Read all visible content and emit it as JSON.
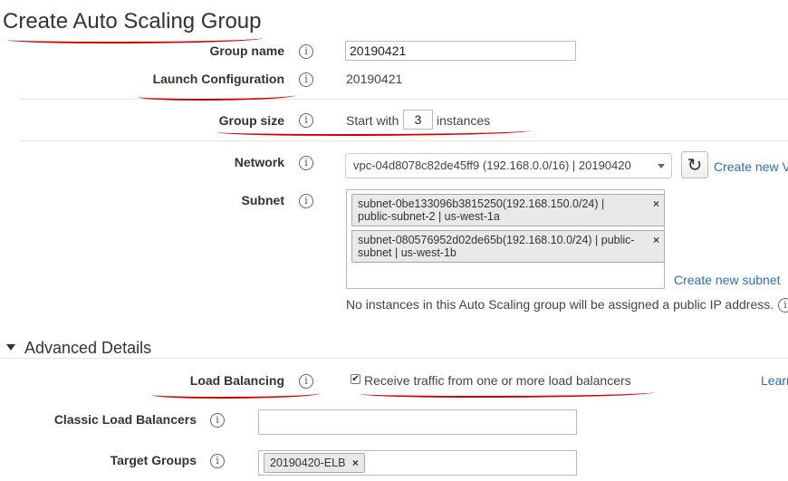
{
  "page_title": "Create Auto Scaling Group",
  "group_name": {
    "label": "Group name",
    "value": "20190421"
  },
  "launch_configuration": {
    "label": "Launch Configuration",
    "value": "20190421"
  },
  "group_size": {
    "label": "Group size",
    "prefix": "Start with",
    "value": "3",
    "suffix": "instances"
  },
  "network": {
    "label": "Network",
    "selected": "vpc-04d8078c82de45ff9 (192.168.0.0/16) | 20190420",
    "create_link": "Create new V"
  },
  "subnet": {
    "label": "Subnet",
    "items": [
      {
        "line1": "subnet-0be133096b3815250(192.168.150.0/24) |",
        "line2": "public-subnet-2 | us-west-1a"
      },
      {
        "line1": "subnet-080576952d02de65b(192.168.10.0/24) | public-",
        "line2": "subnet | us-west-1b"
      }
    ],
    "remove_glyph": "×",
    "create_link": "Create new subnet",
    "note": "No instances in this Auto Scaling group will be assigned a public IP address."
  },
  "advanced": {
    "section_title": "Advanced Details",
    "load_balancing": {
      "label": "Load Balancing",
      "checkbox_label": "Receive traffic from one or more load balancers",
      "checked": true,
      "learn_link": "Learn"
    },
    "classic_lb": {
      "label": "Classic Load Balancers",
      "value": ""
    },
    "target_groups": {
      "label": "Target Groups",
      "tags": [
        "20190420-ELB"
      ],
      "remove_glyph": "×"
    }
  },
  "info_glyph": "i",
  "colors": {
    "annotation": "#d40000",
    "link": "#2a6fb4"
  }
}
